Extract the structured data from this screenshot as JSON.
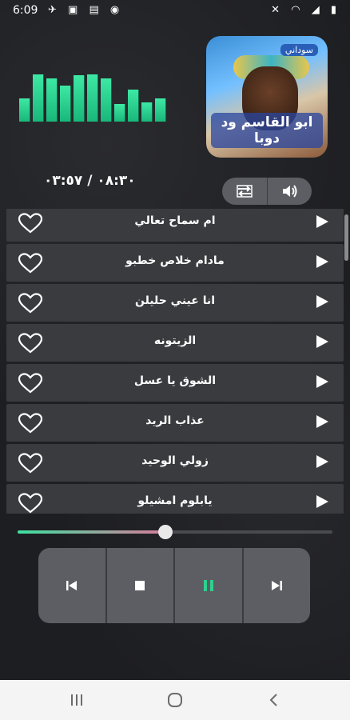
{
  "status_bar": {
    "time": "6:09",
    "left_icons": [
      "telegram-icon",
      "image-icon",
      "gallery-icon",
      "whatsapp-icon"
    ],
    "right_icons": [
      "mute-icon",
      "wifi-icon",
      "signal-icon",
      "battery-icon"
    ]
  },
  "equalizer": {
    "levels": [
      0.45,
      0.92,
      0.85,
      0.7,
      0.9,
      0.92,
      0.85,
      0.35,
      0.62,
      0.38,
      0.45
    ],
    "color": "#2fd08e"
  },
  "album": {
    "title": "ابو القاسم ود دوبا",
    "tag": "سوداني"
  },
  "player": {
    "time_display": "٠٨:٣٠ / ٠٣:٥٧",
    "progress": 0.47
  },
  "pill_buttons": [
    {
      "name": "repeat-button",
      "icon": "repeat-icon"
    },
    {
      "name": "volume-button",
      "icon": "volume-icon"
    }
  ],
  "songs": [
    {
      "title": "ام سماح تعالي"
    },
    {
      "title": "مادام خلاص خطبو"
    },
    {
      "title": "انا عيني حليلن"
    },
    {
      "title": "الزيتونه"
    },
    {
      "title": "الشوق يا عسل"
    },
    {
      "title": "عذاب الريد"
    },
    {
      "title": "زولي الوحيد"
    },
    {
      "title": "يابلوم امشيلو"
    }
  ],
  "controls": [
    {
      "name": "previous-button",
      "icon": "skip-previous-icon"
    },
    {
      "name": "stop-button",
      "icon": "stop-icon"
    },
    {
      "name": "pause-button",
      "icon": "pause-icon",
      "accent": "#2fd08e"
    },
    {
      "name": "next-button",
      "icon": "skip-next-icon"
    }
  ],
  "nav_bar": [
    "recent-apps-icon",
    "home-icon",
    "back-icon"
  ]
}
